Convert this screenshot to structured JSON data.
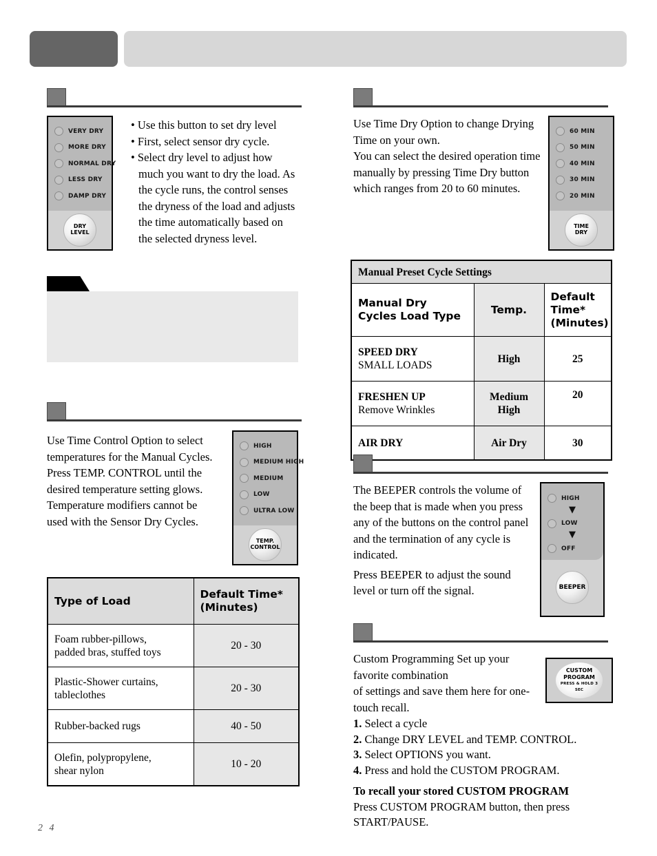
{
  "page": {
    "number": "2 4"
  },
  "header": {
    "left_block_label": "",
    "right_block_label": ""
  },
  "dry_level": {
    "panel": {
      "leds": [
        "VERY DRY",
        "MORE DRY",
        "NORMAL DRY",
        "LESS DRY",
        "DAMP DRY"
      ],
      "button_line1": "DRY",
      "button_line2": "LEVEL"
    },
    "bullets": [
      "Use this button to set dry level",
      "First, select sensor dry cycle.",
      "Select dry level to adjust how much you want to dry the load. As the cycle runs, the control senses the dryness of the load and adjusts the time automatically based on the selected dryness level."
    ]
  },
  "note": {
    "tab_label": "",
    "body": ""
  },
  "temp_control": {
    "panel": {
      "leds": [
        "HIGH",
        "MEDIUM HIGH",
        "MEDIUM",
        "LOW",
        "ULTRA LOW"
      ],
      "button_line1": "TEMP.",
      "button_line2": "CONTROL"
    },
    "body": "Use Time Control Option to select temperatures for the Manual Cycles. Press TEMP. CONTROL until the desired temperature setting glows. Temperature modifiers cannot be used with the Sensor Dry Cycles."
  },
  "load_table": {
    "headers": [
      "Type of Load",
      "Default Time*\n(Minutes)"
    ],
    "header_col1": "Type of Load",
    "header_col2_line1": "Default Time*",
    "header_col2_line2": "(Minutes)",
    "rows": [
      {
        "load_line1": "Foam rubber-pillows,",
        "load_line2": "padded bras, stuffed toys",
        "time": "20 - 30"
      },
      {
        "load_line1": "Plastic-Shower curtains,",
        "load_line2": "tableclothes",
        "time": "20 - 30"
      },
      {
        "load_line1": "Rubber-backed rugs",
        "load_line2": "",
        "time": "40 - 50"
      },
      {
        "load_line1": "Olefin, polypropylene,",
        "load_line2": "shear nylon",
        "time": "10 - 20"
      }
    ]
  },
  "time_dry": {
    "panel": {
      "leds": [
        "60 MIN",
        "50 MIN",
        "40 MIN",
        "30 MIN",
        "20 MIN"
      ],
      "button_line1": "TIME",
      "button_line2": "DRY"
    },
    "body": "Use Time Dry Option to change Drying Time on your own.\nYou can select the desired operation time manually by pressing Time Dry button which ranges from 20 to 60 minutes."
  },
  "manual_preset_table": {
    "title": "Manual Preset Cycle Settings",
    "header_col1_line1": "Manual Dry",
    "header_col1_line2": "Cycles Load Type",
    "header_col2": "Temp.",
    "header_col3_line1": "Default Time*",
    "header_col3_line2": "(Minutes)",
    "rows": [
      {
        "cycle_line1": "SPEED DRY",
        "cycle_line2": "SMALL LOADS",
        "temp_line1": "High",
        "temp_line2": "",
        "time": "25"
      },
      {
        "cycle_line1": "FRESHEN UP",
        "cycle_line2": "Remove Wrinkles",
        "temp_line1": "Medium",
        "temp_line2": "High",
        "time": "20"
      },
      {
        "cycle_line1": "AIR DRY",
        "cycle_line2": "",
        "temp_line1": "Air Dry",
        "temp_line2": "",
        "time": "30"
      }
    ]
  },
  "beeper": {
    "panel": {
      "leds": [
        "HIGH",
        "LOW",
        "OFF"
      ],
      "arrow": "▼",
      "button_label": "BEEPER"
    },
    "paragraph1": "The BEEPER controls the volume of the beep that is made when you press any of the buttons on the control panel and the termination of any cycle is indicated.",
    "paragraph2": "Press BEEPER to adjust the sound level or turn off the signal."
  },
  "custom_program": {
    "intro": "Custom Programming Set up your favorite combination\nof settings and save them here for one-touch recall.",
    "button": {
      "line1": "CUSTOM",
      "line2": "PROGRAM",
      "line3": "PRESS & HOLD 3 SEC"
    },
    "steps": [
      {
        "num": "1.",
        "text": "Select a cycle"
      },
      {
        "num": "2.",
        "text": "Change DRY LEVEL and TEMP. CONTROL."
      },
      {
        "num": "3.",
        "text": "Select OPTIONS you want."
      },
      {
        "num": "4.",
        "text": "Press and hold the CUSTOM PROGRAM."
      }
    ],
    "recall_heading": "To recall your stored CUSTOM PROGRAM",
    "recall_body": "Press CUSTOM PROGRAM button, then press START/PAUSE."
  },
  "colors": {
    "header_dark": "#656565",
    "header_light": "#d7d7d7",
    "section_square": "#7b7b7b",
    "panel_led_bg": "#b9b9b9",
    "panel_btn_bg": "#d2d2d2",
    "note_bg": "#e9e9e9",
    "table_shade": "#e7e7e7",
    "table_title_bg": "#dcdcdc"
  }
}
